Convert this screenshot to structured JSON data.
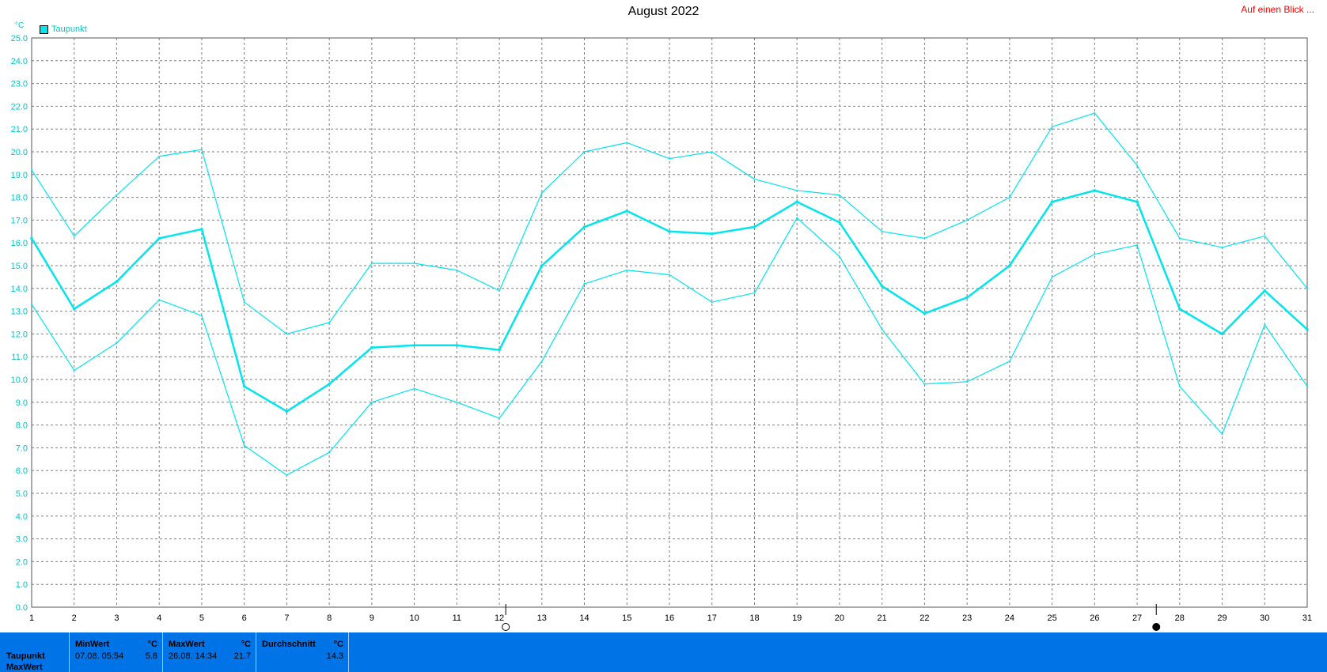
{
  "title": "August 2022",
  "link_text": "Auf einen Blick ...",
  "unit": "°C",
  "legend": [
    {
      "label": "Taupunkt",
      "color": "#00e5ee"
    }
  ],
  "colors": {
    "series": "#00e5ee",
    "axis_text": "#00c8c8",
    "grid": "#808080",
    "panel": "#0073e6",
    "link": "#ff0000"
  },
  "chart_data": {
    "type": "line",
    "title": "August 2022",
    "ylabel": "°C",
    "ylim": [
      0,
      25
    ],
    "xlim": [
      1,
      31
    ],
    "grid": true,
    "legend_placement": "top-left",
    "y_ticks": [
      "0.0",
      "1.0",
      "2.0",
      "3.0",
      "4.0",
      "5.0",
      "6.0",
      "7.0",
      "8.0",
      "9.0",
      "10.0",
      "11.0",
      "12.0",
      "13.0",
      "14.0",
      "15.0",
      "16.0",
      "17.0",
      "18.0",
      "19.0",
      "20.0",
      "21.0",
      "22.0",
      "23.0",
      "24.0",
      "25.0"
    ],
    "x": [
      1,
      2,
      3,
      4,
      5,
      6,
      7,
      8,
      9,
      10,
      11,
      12,
      13,
      14,
      15,
      16,
      17,
      18,
      19,
      20,
      21,
      22,
      23,
      24,
      25,
      26,
      27,
      28,
      29,
      30,
      31
    ],
    "x_labels": [
      "1",
      "2",
      "3",
      "4",
      "5",
      "6",
      "7",
      "8",
      "9",
      "10",
      "11",
      "12",
      "13",
      "14",
      "15",
      "16",
      "17",
      "18",
      "19",
      "20",
      "21",
      "22",
      "23",
      "24",
      "25",
      "26",
      "27",
      "28",
      "29",
      "30",
      "31"
    ],
    "moon_phase_markers": [
      {
        "day": 12.15,
        "phase": "full-moon"
      },
      {
        "day": 27.45,
        "phase": "new-moon"
      }
    ],
    "series": [
      {
        "role": "max",
        "values": [
          19.2,
          16.3,
          18.1,
          19.8,
          20.1,
          13.4,
          12.0,
          12.5,
          15.1,
          15.1,
          14.8,
          13.9,
          18.2,
          20.0,
          20.4,
          19.7,
          20.0,
          18.8,
          18.3,
          18.1,
          16.5,
          16.2,
          17.0,
          18.0,
          21.1,
          21.7,
          19.4,
          16.2,
          15.8,
          16.3,
          14.0
        ]
      },
      {
        "role": "mean",
        "values": [
          16.2,
          13.1,
          14.3,
          16.2,
          16.6,
          9.7,
          8.6,
          9.8,
          11.4,
          11.5,
          11.5,
          11.3,
          15.0,
          16.7,
          17.4,
          16.5,
          16.4,
          16.7,
          17.8,
          16.9,
          14.1,
          12.9,
          13.6,
          15.0,
          17.8,
          18.3,
          17.8,
          13.1,
          12.0,
          13.9,
          12.2
        ]
      },
      {
        "role": "min",
        "values": [
          13.3,
          10.4,
          11.6,
          13.5,
          12.8,
          7.1,
          5.8,
          6.8,
          9.0,
          9.6,
          9.0,
          8.3,
          10.8,
          14.2,
          14.8,
          14.6,
          13.4,
          13.8,
          17.1,
          15.4,
          12.2,
          9.8,
          9.9,
          10.8,
          14.5,
          15.5,
          15.9,
          9.7,
          7.6,
          12.4,
          9.7
        ]
      }
    ]
  },
  "stats": {
    "row_labels": [
      "Taupunkt",
      "MaxWert"
    ],
    "min": {
      "header": "MinWert",
      "unit": "°C",
      "date": "07.08.  05:54",
      "value": "5.8"
    },
    "max": {
      "header": "MaxWert",
      "unit": "°C",
      "date": "26.08.  14:34",
      "value": "21.7"
    },
    "avg": {
      "header": "Durchschnitt",
      "unit": "°C",
      "value": "14.3"
    }
  }
}
